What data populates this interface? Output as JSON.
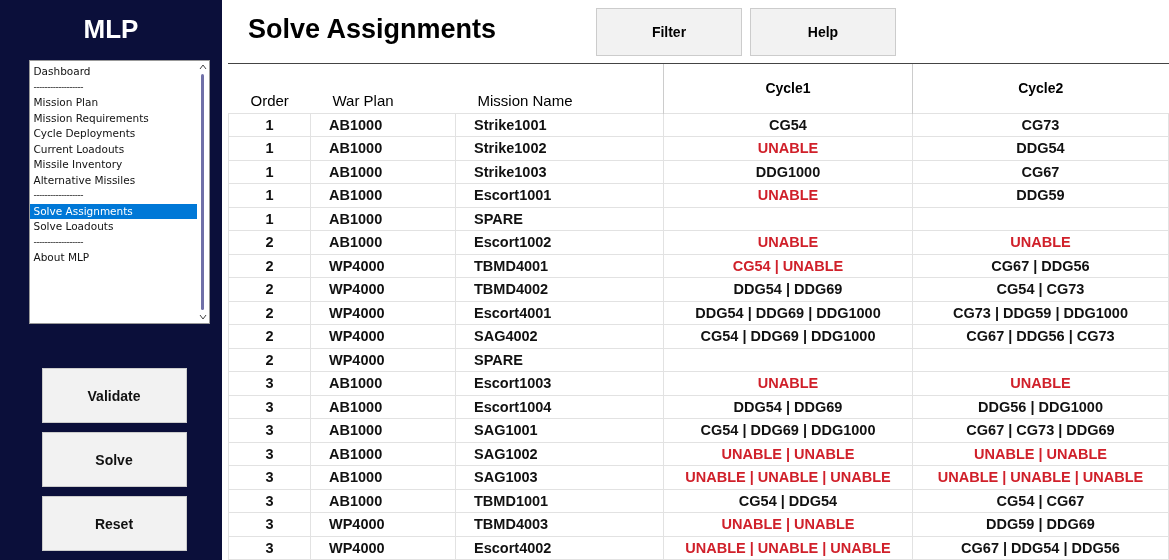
{
  "sidebar": {
    "app_title": "MLP",
    "menu": [
      {
        "label": "Dashboard",
        "kind": "item",
        "selected": false
      },
      {
        "label": "------------------",
        "kind": "separator"
      },
      {
        "label": "Mission Plan",
        "kind": "item",
        "selected": false
      },
      {
        "label": "Mission Requirements",
        "kind": "item",
        "selected": false
      },
      {
        "label": "Cycle Deployments",
        "kind": "item",
        "selected": false
      },
      {
        "label": "Current Loadouts",
        "kind": "item",
        "selected": false
      },
      {
        "label": "Missile Inventory",
        "kind": "item",
        "selected": false
      },
      {
        "label": "Alternative Missiles",
        "kind": "item",
        "selected": false
      },
      {
        "label": "------------------",
        "kind": "separator"
      },
      {
        "label": "Solve Assignments",
        "kind": "item",
        "selected": true
      },
      {
        "label": "Solve Loadouts",
        "kind": "item",
        "selected": false
      },
      {
        "label": "------------------",
        "kind": "separator"
      },
      {
        "label": "About MLP",
        "kind": "item",
        "selected": false
      }
    ],
    "buttons": [
      "Validate",
      "Solve",
      "Reset"
    ]
  },
  "page_title": "Solve Assignments",
  "toolbar": [
    "Filter",
    "Help"
  ],
  "table": {
    "columns": [
      {
        "label": "Order",
        "kind": "plain"
      },
      {
        "label": "War Plan",
        "kind": "plain"
      },
      {
        "label": "Mission Name",
        "kind": "plain"
      },
      {
        "label": "Cycle1",
        "kind": "cycle"
      },
      {
        "label": "Cycle2",
        "kind": "cycle"
      }
    ],
    "rows": [
      {
        "order": "1",
        "war_plan": "AB1000",
        "mission": "Strike1001",
        "cycle1": {
          "text": "CG54",
          "unable": false
        },
        "cycle2": {
          "text": "CG73",
          "unable": false
        }
      },
      {
        "order": "1",
        "war_plan": "AB1000",
        "mission": "Strike1002",
        "cycle1": {
          "text": "UNABLE",
          "unable": true
        },
        "cycle2": {
          "text": "DDG54",
          "unable": false
        }
      },
      {
        "order": "1",
        "war_plan": "AB1000",
        "mission": "Strike1003",
        "cycle1": {
          "text": "DDG1000",
          "unable": false
        },
        "cycle2": {
          "text": "CG67",
          "unable": false
        }
      },
      {
        "order": "1",
        "war_plan": "AB1000",
        "mission": "Escort1001",
        "cycle1": {
          "text": "UNABLE",
          "unable": true
        },
        "cycle2": {
          "text": "DDG59",
          "unable": false
        }
      },
      {
        "order": "1",
        "war_plan": "AB1000",
        "mission": "SPARE"
      },
      {
        "order": "2",
        "war_plan": "AB1000",
        "mission": "Escort1002",
        "cycle1": {
          "text": "UNABLE",
          "unable": true
        },
        "cycle2": {
          "text": "UNABLE",
          "unable": true
        }
      },
      {
        "order": "2",
        "war_plan": "WP4000",
        "mission": "TBMD4001",
        "cycle1": {
          "text": "CG54 | UNABLE",
          "unable": true
        },
        "cycle2": {
          "text": "CG67 | DDG56",
          "unable": false
        }
      },
      {
        "order": "2",
        "war_plan": "WP4000",
        "mission": "TBMD4002",
        "cycle1": {
          "text": "DDG54 | DDG69",
          "unable": false
        },
        "cycle2": {
          "text": "CG54 | CG73",
          "unable": false
        }
      },
      {
        "order": "2",
        "war_plan": "WP4000",
        "mission": "Escort4001",
        "cycle1": {
          "text": "DDG54 | DDG69 | DDG1000",
          "unable": false
        },
        "cycle2": {
          "text": "CG73 | DDG59 | DDG1000",
          "unable": false
        }
      },
      {
        "order": "2",
        "war_plan": "WP4000",
        "mission": "SAG4002",
        "cycle1": {
          "text": "CG54 | DDG69 | DDG1000",
          "unable": false
        },
        "cycle2": {
          "text": "CG67 | DDG56 | CG73",
          "unable": false
        }
      },
      {
        "order": "2",
        "war_plan": "WP4000",
        "mission": "SPARE"
      },
      {
        "order": "3",
        "war_plan": "AB1000",
        "mission": "Escort1003",
        "cycle1": {
          "text": "UNABLE",
          "unable": true
        },
        "cycle2": {
          "text": "UNABLE",
          "unable": true
        }
      },
      {
        "order": "3",
        "war_plan": "AB1000",
        "mission": "Escort1004",
        "cycle1": {
          "text": "DDG54 | DDG69",
          "unable": false
        },
        "cycle2": {
          "text": "DDG56 | DDG1000",
          "unable": false
        }
      },
      {
        "order": "3",
        "war_plan": "AB1000",
        "mission": "SAG1001",
        "cycle1": {
          "text": "CG54 | DDG69 | DDG1000",
          "unable": false
        },
        "cycle2": {
          "text": "CG67 | CG73 | DDG69",
          "unable": false
        }
      },
      {
        "order": "3",
        "war_plan": "AB1000",
        "mission": "SAG1002",
        "cycle1": {
          "text": "UNABLE | UNABLE",
          "unable": true
        },
        "cycle2": {
          "text": "UNABLE | UNABLE",
          "unable": true
        }
      },
      {
        "order": "3",
        "war_plan": "AB1000",
        "mission": "SAG1003",
        "cycle1": {
          "text": "UNABLE | UNABLE | UNABLE",
          "unable": true
        },
        "cycle2": {
          "text": "UNABLE | UNABLE | UNABLE",
          "unable": true
        }
      },
      {
        "order": "3",
        "war_plan": "AB1000",
        "mission": "TBMD1001",
        "cycle1": {
          "text": "CG54 | DDG54",
          "unable": false
        },
        "cycle2": {
          "text": "CG54 | CG67",
          "unable": false
        }
      },
      {
        "order": "3",
        "war_plan": "WP4000",
        "mission": "TBMD4003",
        "cycle1": {
          "text": "UNABLE | UNABLE",
          "unable": true
        },
        "cycle2": {
          "text": "DDG59 | DDG69",
          "unable": false
        }
      },
      {
        "order": "3",
        "war_plan": "WP4000",
        "mission": "Escort4002",
        "cycle1": {
          "text": "UNABLE | UNABLE | UNABLE",
          "unable": true
        },
        "cycle2": {
          "text": "CG67 | DDG54 | DDG56",
          "unable": false
        }
      }
    ]
  }
}
